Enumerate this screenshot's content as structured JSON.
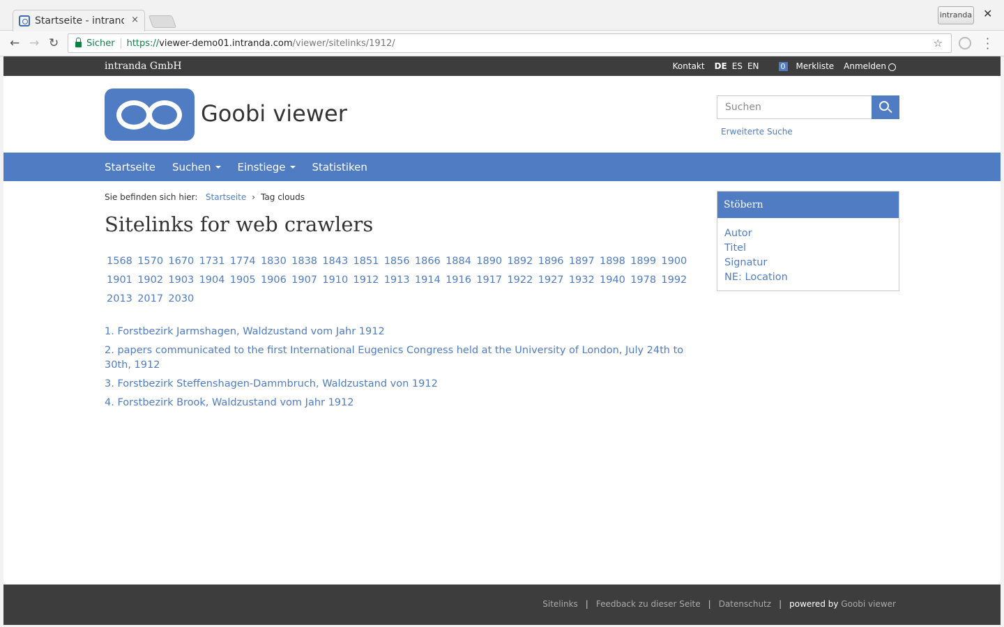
{
  "browser": {
    "tab_title": "Startseite - intranda",
    "tab_close": "×",
    "profile_label": "intranda",
    "window_close": "✕",
    "secure_label": "Sicher",
    "url_proto": "https://",
    "url_host": "viewer-demo01.intranda.com",
    "url_path": "/viewer/sitelinks/1912/"
  },
  "topbar": {
    "brand": "intranda GmbH",
    "contact": "Kontakt",
    "languages": [
      "DE",
      "ES",
      "EN"
    ],
    "bookmark_count": "0",
    "bookmarks": "Merkliste",
    "login": "Anmelden"
  },
  "header": {
    "title": "Goobi viewer",
    "search_placeholder": "Suchen",
    "advanced_search": "Erweiterte Suche"
  },
  "nav": {
    "items": [
      "Startseite",
      "Suchen",
      "Einstiege",
      "Statistiken"
    ]
  },
  "breadcrumb": {
    "prefix": "Sie befinden sich hier:",
    "home": "Startseite",
    "current": "Tag clouds"
  },
  "page": {
    "heading": "Sitelinks for web crawlers"
  },
  "years": [
    "1568",
    "1570",
    "1670",
    "1731",
    "1774",
    "1830",
    "1838",
    "1843",
    "1851",
    "1856",
    "1866",
    "1884",
    "1890",
    "1892",
    "1896",
    "1897",
    "1898",
    "1899",
    "1900",
    "1901",
    "1902",
    "1903",
    "1904",
    "1905",
    "1906",
    "1907",
    "1910",
    "1912",
    "1913",
    "1914",
    "1916",
    "1917",
    "1922",
    "1927",
    "1932",
    "1940",
    "1978",
    "1992",
    "2013",
    "2017",
    "2030"
  ],
  "results": [
    "1. Forstbezirk Jarmshagen, Waldzustand vom Jahr 1912",
    "2. papers communicated to the first International Eugenics Congress held at the University of London, July 24th to 30th, 1912",
    "3. Forstbezirk Steffenshagen-Dammbruch, Waldzustand von 1912",
    "4. Forstbezirk Brook, Waldzustand vom Jahr 1912"
  ],
  "sidebar": {
    "title": "Stöbern",
    "items": [
      "Autor",
      "Titel",
      "Signatur",
      "NE: Location"
    ]
  },
  "footer": {
    "sitelinks": "Sitelinks",
    "feedback": "Feedback zu dieser Seite",
    "privacy": "Datenschutz",
    "powered_by": "powered by",
    "powered_name": "Goobi viewer"
  },
  "colors": {
    "accent": "#4f7cc3",
    "dark": "#3d3d3d"
  }
}
